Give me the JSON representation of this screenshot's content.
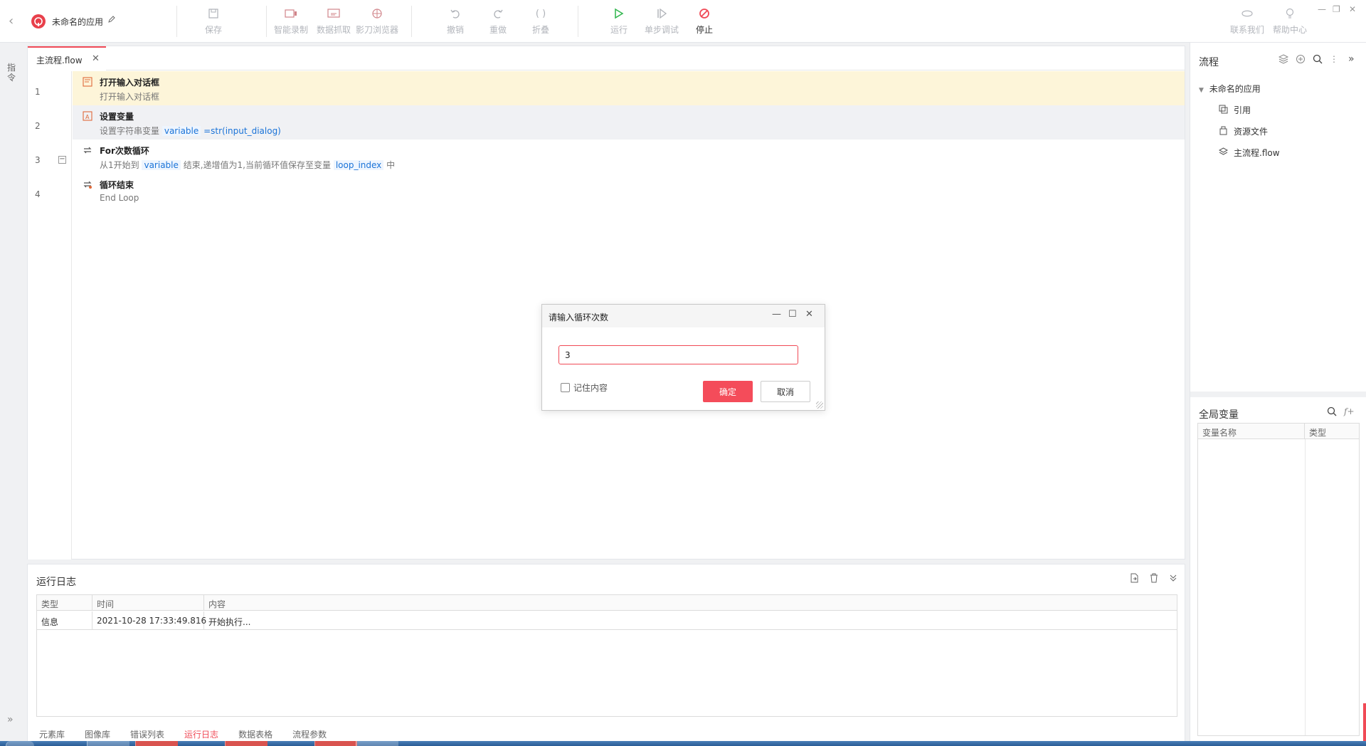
{
  "app": {
    "name": "未命名的应用"
  },
  "toolbar": {
    "save": "保存",
    "smart_record": "智能录制",
    "data_capture": "数据抓取",
    "browser": "影刀浏览器",
    "undo": "撤销",
    "redo": "重做",
    "fold": "折叠",
    "run": "运行",
    "step_debug": "单步调试",
    "stop": "停止",
    "contact": "联系我们",
    "help": "帮助中心"
  },
  "sidebar": {
    "commands": "指令"
  },
  "editor": {
    "tab": "主流程.flow",
    "lines": [
      {
        "num": "1",
        "title": "打开输入对话框",
        "desc": "打开输入对话框"
      },
      {
        "num": "2",
        "title": "设置变量",
        "desc_prefix": "设置字符串变量",
        "var": "variable",
        "desc_suffix": "=str(input_dialog)"
      },
      {
        "num": "3",
        "title": "For次数循环",
        "desc_prefix": "从1开始到",
        "var": "variable",
        "desc_mid": "结束,递增值为1,当前循环值保存至变量",
        "var2": "loop_index",
        "desc_suffix": "中"
      },
      {
        "num": "4",
        "title": "循环结束",
        "desc": "End Loop"
      }
    ]
  },
  "log": {
    "title": "运行日志",
    "columns": [
      "类型",
      "时间",
      "内容"
    ],
    "rows": [
      {
        "type": "信息",
        "time": "2021-10-28 17:33:49.816",
        "content": "开始执行..."
      }
    ],
    "tabs": [
      "元素库",
      "图像库",
      "错误列表",
      "运行日志",
      "数据表格",
      "流程参数"
    ],
    "active_tab": "运行日志"
  },
  "right": {
    "title": "流程",
    "root": "未命名的应用",
    "items": [
      "引用",
      "资源文件",
      "主流程.flow"
    ],
    "global_vars": {
      "title": "全局变量",
      "columns": [
        "变量名称",
        "类型"
      ]
    }
  },
  "dialog": {
    "title": "请输入循环次数",
    "value": "3",
    "remember": "记住内容",
    "ok": "确定",
    "cancel": "取消"
  },
  "colors": {
    "accent": "#f04a56",
    "highlight_row": "#fdf5d9",
    "variable": "#1a73d8",
    "run_green": "#2fb54c"
  }
}
